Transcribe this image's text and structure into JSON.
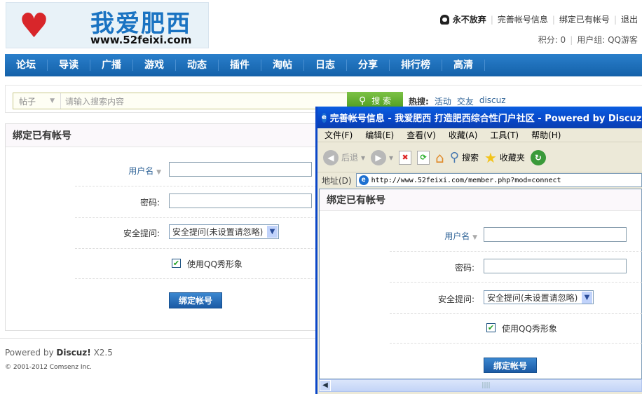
{
  "header": {
    "logo_cn": "我爱肥西",
    "logo_url": "www.52feixi.com",
    "username": "永不放弃",
    "links": [
      "完善帐号信息",
      "绑定已有帐号",
      "退出"
    ],
    "points_label": "积分: 0",
    "usergroup_label": "用户组: QQ游客"
  },
  "nav": [
    "论坛",
    "导读",
    "广播",
    "游戏",
    "动态",
    "插件",
    "淘帖",
    "日志",
    "分享",
    "排行榜",
    "高清"
  ],
  "search": {
    "type": "帖子",
    "placeholder": "请输入搜索内容",
    "button": "搜 索",
    "hot_label": "热搜:",
    "hot": [
      "活动",
      "交友",
      "discuz"
    ]
  },
  "form": {
    "title": "绑定已有帐号",
    "username_label": "用户名",
    "password_label": "密码:",
    "question_label": "安全提问:",
    "question_value": "安全提问(未设置请忽略)",
    "qqshow_label": "使用QQ秀形象",
    "qqshow_checked": true,
    "submit": "绑定帐号"
  },
  "footer": {
    "powered": "Powered by",
    "brand": "Discuz!",
    "version": "X2.5",
    "copyright": "© 2001-2012 Comsenz Inc."
  },
  "popup": {
    "title": "完善帐号信息 - 我爱肥西 打造肥西综合性门户社区 - Powered by Discuz!",
    "menu": [
      "文件(F)",
      "编辑(E)",
      "查看(V)",
      "收藏(A)",
      "工具(T)",
      "帮助(H)"
    ],
    "toolbar": {
      "back": "后退",
      "search": "搜索",
      "favorites": "收藏夹"
    },
    "address_label": "地址(D)",
    "url": "http://www.52feixi.com/member.php?mod=connect"
  }
}
